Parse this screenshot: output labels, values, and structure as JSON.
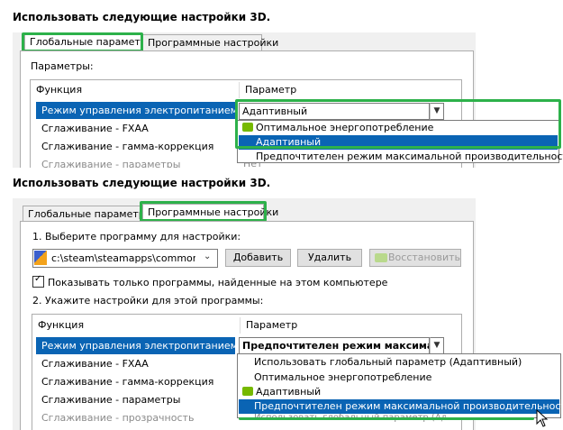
{
  "top": {
    "heading": "Использовать следующие настройки 3D.",
    "tabs": [
      "Глобальные параметры",
      "Программные настройки"
    ],
    "params_label": "Параметры:",
    "col_function": "Функция",
    "col_param": "Параметр",
    "rows": [
      "Режим управления электропитанием",
      "Сглаживание - FXAA",
      "Сглаживание - гамма-коррекция",
      "Сглаживание - параметры"
    ],
    "combo_value": "Адаптивный",
    "options": [
      "Оптимальное энергопотребление",
      "Адаптивный",
      "Предпочтителен режим максимальной производительности"
    ],
    "cut_value": "Нет"
  },
  "bottom": {
    "heading": "Использовать следующие настройки 3D.",
    "tabs": [
      "Глобальные параметры",
      "Программные настройки"
    ],
    "step1": "1. Выберите программу для настройки:",
    "program_path": "c:\\steam\\steamapps\\common\\c...",
    "btn_add": "Добавить",
    "btn_remove": "Удалить",
    "btn_restore": "Восстановить",
    "checkbox_label": "Показывать только программы, найденные на этом компьютере",
    "step2": "2. Укажите настройки для этой программы:",
    "col_function": "Функция",
    "col_param": "Параметр",
    "rows": [
      "Режим управления электропитанием",
      "Сглаживание - FXAA",
      "Сглаживание - гамма-коррекция",
      "Сглаживание - параметры",
      "Сглаживание - прозрачность"
    ],
    "combo_value": "Предпочтителен режим максималь",
    "options": [
      "Использовать глобальный параметр (Адаптивный)",
      "Оптимальное энергопотребление",
      "Адаптивный",
      "Предпочтителен режим максимальной производительности"
    ],
    "cut_option": "Использовать глобальный параметр (Ад"
  },
  "colors": {
    "selection": "#0a64b4",
    "highlight_green": "#2db14a",
    "nvidia": "#76b900"
  }
}
